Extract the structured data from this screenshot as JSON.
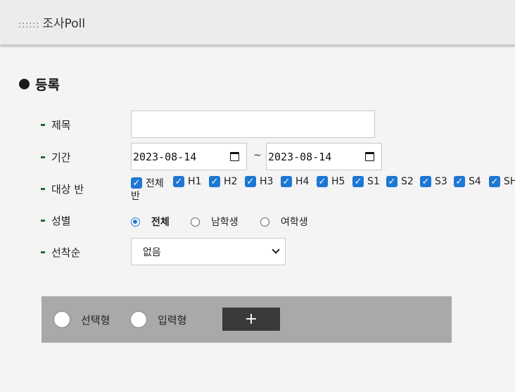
{
  "header": {
    "dots": "::::::",
    "title": "조사Poll"
  },
  "section": {
    "title": "등록"
  },
  "form": {
    "title_label": "제목",
    "title_value": "",
    "period_label": "기간",
    "start_date": "2023-08-14",
    "end_date": "2023-08-14",
    "separator": "~",
    "class_label": "대상 반",
    "classes": [
      "전체",
      "H1",
      "H2",
      "H3",
      "H4",
      "H5",
      "S1",
      "S2",
      "S3",
      "S4",
      "SH"
    ],
    "class_wrap_tail": "반",
    "gender_label": "성별",
    "gender_options": [
      "전체",
      "남학생",
      "여학생"
    ],
    "gender_selected": "전체",
    "order_label": "선착순",
    "order_value": "없음"
  },
  "question": {
    "option_choice": "선택형",
    "option_input": "입력형",
    "add_label": "+"
  },
  "colors": {
    "accent": "#1e77d3",
    "dash": "#1f6b33",
    "bar": "#a9a9a9",
    "button": "#3a3a3a"
  }
}
